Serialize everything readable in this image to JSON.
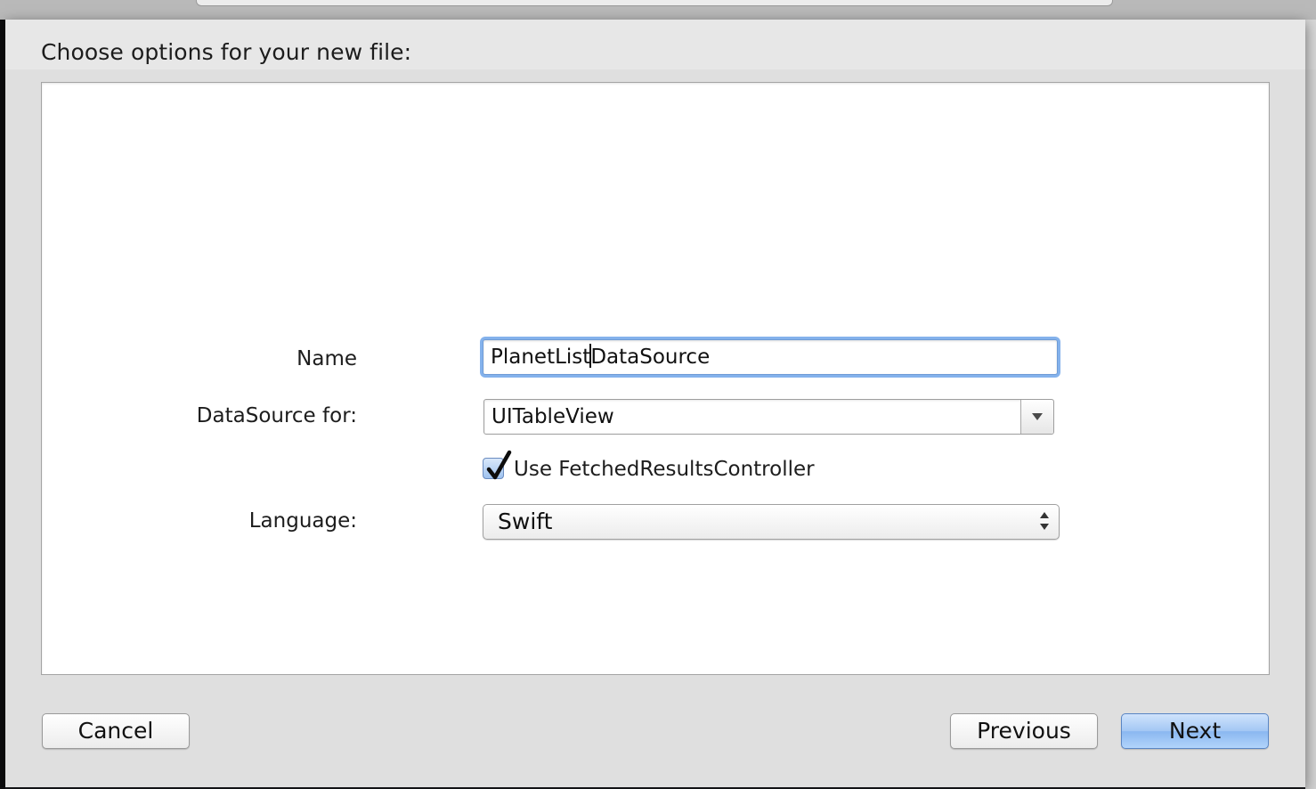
{
  "dialog": {
    "title": "Choose options for your new file:",
    "accent_color": "#84b2ec"
  },
  "form": {
    "name": {
      "label": "Name",
      "value_before_cursor": "PlanetList",
      "value_after_cursor": "DataSource"
    },
    "datasource": {
      "label": "DataSource for:",
      "value": "UITableView",
      "arrow_icon": "chevron-down-icon"
    },
    "fetched_results": {
      "label": "Use FetchedResultsController",
      "checked": true
    },
    "language": {
      "label": "Language:",
      "selected": "Swift",
      "arrow_icon": "up-down-arrows-icon"
    }
  },
  "buttons": {
    "cancel": "Cancel",
    "previous": "Previous",
    "next": "Next"
  }
}
